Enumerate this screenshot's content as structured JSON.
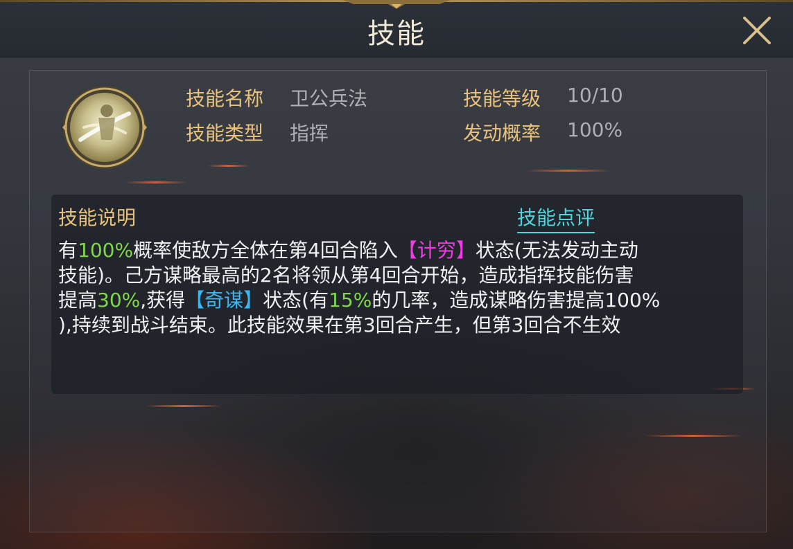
{
  "header": {
    "title": "技能"
  },
  "skill": {
    "name_label": "技能名称",
    "name_value": "卫公兵法",
    "level_label": "技能等级",
    "level_value": "10/10",
    "type_label": "技能类型",
    "type_value": "指挥",
    "chance_label": "发动概率",
    "chance_value": "100%"
  },
  "description": {
    "heading": "技能说明",
    "review_link": "技能点评",
    "lines": [
      [
        {
          "text": "有",
          "style": "normal"
        },
        {
          "text": "100%",
          "style": "green"
        },
        {
          "text": "概率使敌方全体在第4回合陷入",
          "style": "normal"
        },
        {
          "text": "【计穷】",
          "style": "magenta"
        },
        {
          "text": "状态(无法发动主动",
          "style": "normal"
        }
      ],
      [
        {
          "text": "技能)。己方谋略最高的2名将领从第4回合开始，造成指挥技能伤害",
          "style": "normal"
        }
      ],
      [
        {
          "text": "提高",
          "style": "normal"
        },
        {
          "text": "30%",
          "style": "green"
        },
        {
          "text": ",获得",
          "style": "normal"
        },
        {
          "text": "【奇谋】",
          "style": "blue"
        },
        {
          "text": "状态(有",
          "style": "normal"
        },
        {
          "text": "15%",
          "style": "green"
        },
        {
          "text": "的几率，造成谋略伤害提高100%",
          "style": "normal"
        }
      ],
      [
        {
          "text": "),持续到战斗结束。此技能效果在第3回合产生，但第3回合不生效",
          "style": "normal"
        }
      ]
    ]
  },
  "colors": {
    "label_gold": "#e9c27c",
    "value_gray": "#aeb0b4",
    "highlight_green": "#7ed84a",
    "highlight_magenta": "#f13ce6",
    "highlight_blue": "#3cb6f0",
    "link_cyan": "#4fd6dc"
  },
  "icons": {
    "skill_icon": "warrior-emblem-icon",
    "close": "close-icon"
  }
}
